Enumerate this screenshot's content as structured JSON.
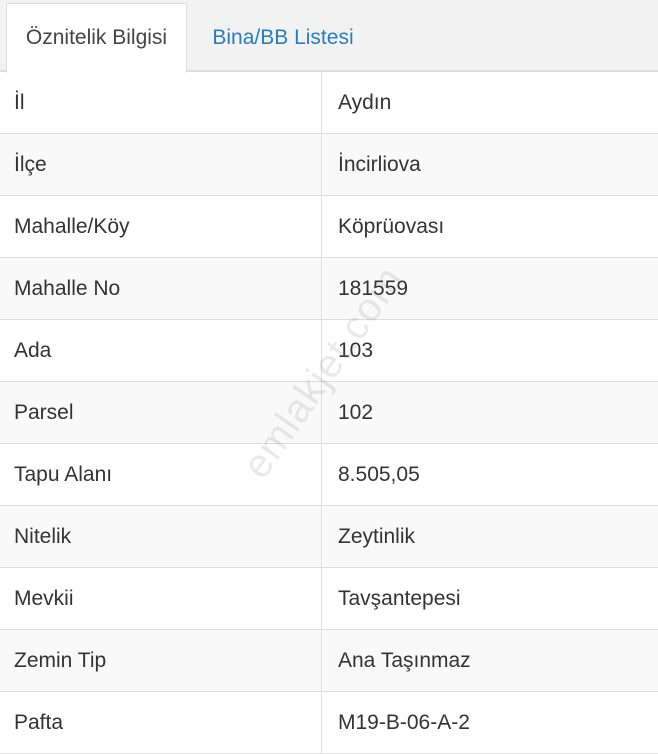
{
  "tabs": [
    {
      "label": "Öznitelik Bilgisi",
      "active": true
    },
    {
      "label": "Bina/BB Listesi",
      "active": false
    }
  ],
  "rows": [
    {
      "key": "İl",
      "value": "Aydın"
    },
    {
      "key": "İlçe",
      "value": "İncirliova"
    },
    {
      "key": "Mahalle/Köy",
      "value": "Köprüovası"
    },
    {
      "key": "Mahalle No",
      "value": "181559"
    },
    {
      "key": "Ada",
      "value": "103"
    },
    {
      "key": "Parsel",
      "value": "102"
    },
    {
      "key": "Tapu Alanı",
      "value": "8.505,05"
    },
    {
      "key": "Nitelik",
      "value": "Zeytinlik"
    },
    {
      "key": "Mevkii",
      "value": "Tavşantepesi"
    },
    {
      "key": "Zemin Tip",
      "value": "Ana Taşınmaz"
    },
    {
      "key": "Pafta",
      "value": "M19-B-06-A-2"
    }
  ],
  "watermark": "emlakjet.com",
  "colors": {
    "tab_link": "#2f7bb6",
    "border": "#dddddd",
    "row_alt": "#f9f9f9"
  }
}
